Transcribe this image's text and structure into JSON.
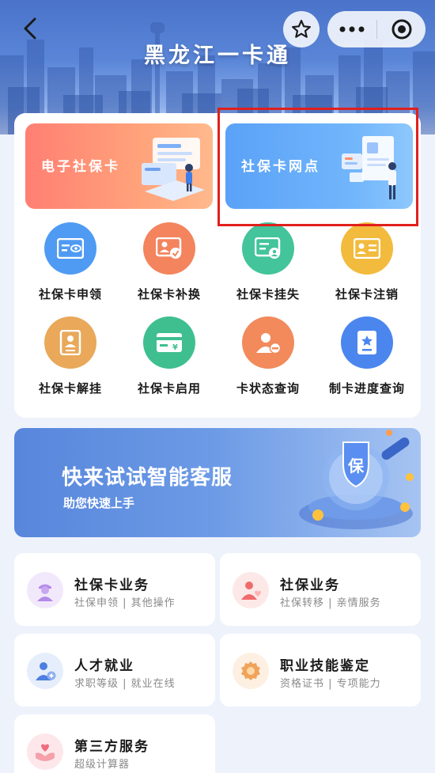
{
  "header": {
    "title": "黑龙江一卡通",
    "back_icon": "chevron-left-icon",
    "favorite_icon": "star-icon",
    "more_icon": "ellipsis-icon",
    "close_icon": "target-circle-icon"
  },
  "banners": {
    "ecard": {
      "label": "电子社保卡",
      "color": "#ff8a78"
    },
    "outlet": {
      "label": "社保卡网点",
      "color": "#6aaefa",
      "highlighted": true,
      "highlight_color": "#e0201c"
    }
  },
  "grid": [
    {
      "label": "社保卡申领",
      "icon": "id-card-eye-icon",
      "color": "#4f9bf3"
    },
    {
      "label": "社保卡补换",
      "icon": "id-card-check-icon",
      "color": "#f3845d"
    },
    {
      "label": "社保卡挂失",
      "icon": "id-card-lock-icon",
      "color": "#43c49a"
    },
    {
      "label": "社保卡注销",
      "icon": "id-card-lines-icon",
      "color": "#f2bb3e"
    },
    {
      "label": "社保卡解挂",
      "icon": "document-person-icon",
      "color": "#e9a85a"
    },
    {
      "label": "社保卡启用",
      "icon": "card-yen-icon",
      "color": "#3fbf8f"
    },
    {
      "label": "卡状态查询",
      "icon": "person-minus-icon",
      "color": "#f28a5c"
    },
    {
      "label": "制卡进度查询",
      "icon": "badge-star-icon",
      "color": "#4a86ee"
    }
  ],
  "service_banner": {
    "title": "快来试试智能客服",
    "subtitle": "助您快速上手",
    "shield_text": "保"
  },
  "services": [
    {
      "title": "社保卡业务",
      "subtitle": "社保申领 | 其他操作",
      "icon": "person-cap-icon",
      "color": "#b48ae8",
      "bg": "#f1e9fb"
    },
    {
      "title": "社保业务",
      "subtitle": "社保转移 | 亲情服务",
      "icon": "person-heart-icon",
      "color": "#f06b6b",
      "bg": "#fde8e8"
    },
    {
      "title": "人才就业",
      "subtitle": "求职等级 | 就业在线",
      "icon": "person-add-icon",
      "color": "#4d7fe0",
      "bg": "#e6eefc"
    },
    {
      "title": "职业技能鉴定",
      "subtitle": "资格证书 | 专项能力",
      "icon": "award-seal-icon",
      "color": "#f0a35a",
      "bg": "#fdf0e3"
    },
    {
      "title": "第三方服务",
      "subtitle": "超级计算器",
      "icon": "hands-heart-icon",
      "color": "#ef6c7d",
      "bg": "#fde7ea"
    }
  ]
}
